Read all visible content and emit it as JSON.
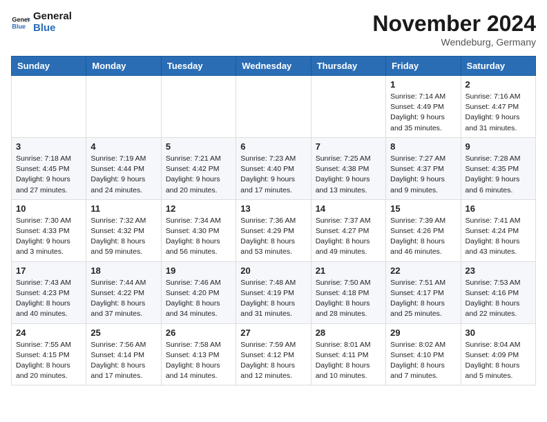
{
  "header": {
    "logo_line1": "General",
    "logo_line2": "Blue",
    "month": "November 2024",
    "location": "Wendeburg, Germany"
  },
  "weekdays": [
    "Sunday",
    "Monday",
    "Tuesday",
    "Wednesday",
    "Thursday",
    "Friday",
    "Saturday"
  ],
  "weeks": [
    [
      {
        "day": "",
        "info": ""
      },
      {
        "day": "",
        "info": ""
      },
      {
        "day": "",
        "info": ""
      },
      {
        "day": "",
        "info": ""
      },
      {
        "day": "",
        "info": ""
      },
      {
        "day": "1",
        "info": "Sunrise: 7:14 AM\nSunset: 4:49 PM\nDaylight: 9 hours\nand 35 minutes."
      },
      {
        "day": "2",
        "info": "Sunrise: 7:16 AM\nSunset: 4:47 PM\nDaylight: 9 hours\nand 31 minutes."
      }
    ],
    [
      {
        "day": "3",
        "info": "Sunrise: 7:18 AM\nSunset: 4:45 PM\nDaylight: 9 hours\nand 27 minutes."
      },
      {
        "day": "4",
        "info": "Sunrise: 7:19 AM\nSunset: 4:44 PM\nDaylight: 9 hours\nand 24 minutes."
      },
      {
        "day": "5",
        "info": "Sunrise: 7:21 AM\nSunset: 4:42 PM\nDaylight: 9 hours\nand 20 minutes."
      },
      {
        "day": "6",
        "info": "Sunrise: 7:23 AM\nSunset: 4:40 PM\nDaylight: 9 hours\nand 17 minutes."
      },
      {
        "day": "7",
        "info": "Sunrise: 7:25 AM\nSunset: 4:38 PM\nDaylight: 9 hours\nand 13 minutes."
      },
      {
        "day": "8",
        "info": "Sunrise: 7:27 AM\nSunset: 4:37 PM\nDaylight: 9 hours\nand 9 minutes."
      },
      {
        "day": "9",
        "info": "Sunrise: 7:28 AM\nSunset: 4:35 PM\nDaylight: 9 hours\nand 6 minutes."
      }
    ],
    [
      {
        "day": "10",
        "info": "Sunrise: 7:30 AM\nSunset: 4:33 PM\nDaylight: 9 hours\nand 3 minutes."
      },
      {
        "day": "11",
        "info": "Sunrise: 7:32 AM\nSunset: 4:32 PM\nDaylight: 8 hours\nand 59 minutes."
      },
      {
        "day": "12",
        "info": "Sunrise: 7:34 AM\nSunset: 4:30 PM\nDaylight: 8 hours\nand 56 minutes."
      },
      {
        "day": "13",
        "info": "Sunrise: 7:36 AM\nSunset: 4:29 PM\nDaylight: 8 hours\nand 53 minutes."
      },
      {
        "day": "14",
        "info": "Sunrise: 7:37 AM\nSunset: 4:27 PM\nDaylight: 8 hours\nand 49 minutes."
      },
      {
        "day": "15",
        "info": "Sunrise: 7:39 AM\nSunset: 4:26 PM\nDaylight: 8 hours\nand 46 minutes."
      },
      {
        "day": "16",
        "info": "Sunrise: 7:41 AM\nSunset: 4:24 PM\nDaylight: 8 hours\nand 43 minutes."
      }
    ],
    [
      {
        "day": "17",
        "info": "Sunrise: 7:43 AM\nSunset: 4:23 PM\nDaylight: 8 hours\nand 40 minutes."
      },
      {
        "day": "18",
        "info": "Sunrise: 7:44 AM\nSunset: 4:22 PM\nDaylight: 8 hours\nand 37 minutes."
      },
      {
        "day": "19",
        "info": "Sunrise: 7:46 AM\nSunset: 4:20 PM\nDaylight: 8 hours\nand 34 minutes."
      },
      {
        "day": "20",
        "info": "Sunrise: 7:48 AM\nSunset: 4:19 PM\nDaylight: 8 hours\nand 31 minutes."
      },
      {
        "day": "21",
        "info": "Sunrise: 7:50 AM\nSunset: 4:18 PM\nDaylight: 8 hours\nand 28 minutes."
      },
      {
        "day": "22",
        "info": "Sunrise: 7:51 AM\nSunset: 4:17 PM\nDaylight: 8 hours\nand 25 minutes."
      },
      {
        "day": "23",
        "info": "Sunrise: 7:53 AM\nSunset: 4:16 PM\nDaylight: 8 hours\nand 22 minutes."
      }
    ],
    [
      {
        "day": "24",
        "info": "Sunrise: 7:55 AM\nSunset: 4:15 PM\nDaylight: 8 hours\nand 20 minutes."
      },
      {
        "day": "25",
        "info": "Sunrise: 7:56 AM\nSunset: 4:14 PM\nDaylight: 8 hours\nand 17 minutes."
      },
      {
        "day": "26",
        "info": "Sunrise: 7:58 AM\nSunset: 4:13 PM\nDaylight: 8 hours\nand 14 minutes."
      },
      {
        "day": "27",
        "info": "Sunrise: 7:59 AM\nSunset: 4:12 PM\nDaylight: 8 hours\nand 12 minutes."
      },
      {
        "day": "28",
        "info": "Sunrise: 8:01 AM\nSunset: 4:11 PM\nDaylight: 8 hours\nand 10 minutes."
      },
      {
        "day": "29",
        "info": "Sunrise: 8:02 AM\nSunset: 4:10 PM\nDaylight: 8 hours\nand 7 minutes."
      },
      {
        "day": "30",
        "info": "Sunrise: 8:04 AM\nSunset: 4:09 PM\nDaylight: 8 hours\nand 5 minutes."
      }
    ]
  ]
}
